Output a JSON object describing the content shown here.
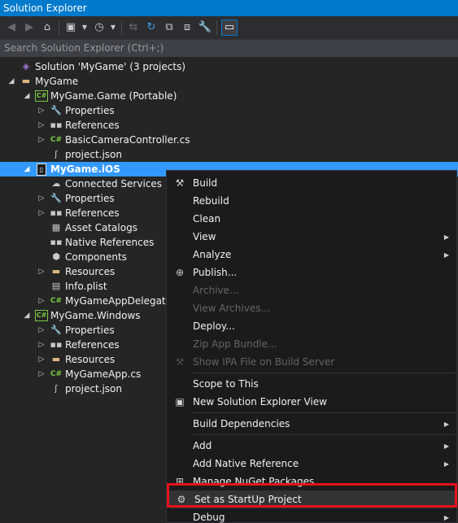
{
  "window": {
    "title": "Solution Explorer"
  },
  "toolbar": {
    "buttons": [
      {
        "icon": "back-icon",
        "glyph": "◀",
        "enabled": false
      },
      {
        "icon": "forward-icon",
        "glyph": "▶",
        "enabled": false
      },
      {
        "icon": "home-icon",
        "glyph": "⌂",
        "enabled": true
      },
      {
        "icon": "switch-views-icon",
        "glyph": "▣",
        "enabled": true
      },
      {
        "icon": "pending-changes-filter-icon",
        "glyph": "◷",
        "enabled": true
      },
      {
        "icon": "sync-with-active-document-icon",
        "glyph": "⇆",
        "enabled": false
      },
      {
        "icon": "refresh-icon",
        "glyph": "↻",
        "enabled": true
      },
      {
        "icon": "collapse-all-icon",
        "glyph": "⧉",
        "enabled": true
      },
      {
        "icon": "show-all-files-icon",
        "glyph": "⧈",
        "enabled": true
      },
      {
        "icon": "properties-icon",
        "glyph": "🔧",
        "enabled": true
      },
      {
        "icon": "preview-selected-items-icon",
        "glyph": "▭",
        "enabled": true
      }
    ]
  },
  "search": {
    "placeholder": "Search Solution Explorer (Ctrl+;)"
  },
  "tree": [
    {
      "label": "Solution 'MyGame' (3 projects)",
      "icon": "solution-icon",
      "glyph": "◈",
      "depth": 0,
      "expander": ""
    },
    {
      "label": "MyGame",
      "icon": "folder-icon",
      "glyph": "▬",
      "depth": 0,
      "expander": "◢"
    },
    {
      "label": "MyGame.Game (Portable)",
      "icon": "csharp-project-icon",
      "glyph": "C#",
      "depth": 1,
      "expander": "◢"
    },
    {
      "label": "Properties",
      "icon": "wrench-icon",
      "glyph": "🔧",
      "depth": 2,
      "expander": "▷"
    },
    {
      "label": "References",
      "icon": "references-icon",
      "glyph": "▪▪",
      "depth": 2,
      "expander": "▷"
    },
    {
      "label": "BasicCameraController.cs",
      "icon": "csharp-file-icon",
      "glyph": "C#",
      "depth": 2,
      "expander": "▷"
    },
    {
      "label": "project.json",
      "icon": "json-file-icon",
      "glyph": "ʃ",
      "depth": 2,
      "expander": ""
    },
    {
      "label": "MyGame.iOS",
      "icon": "ios-project-icon",
      "glyph": "▯",
      "depth": 1,
      "expander": "◢",
      "selected": true
    },
    {
      "label": "Connected Services",
      "icon": "connected-services-icon",
      "glyph": "☁",
      "depth": 2,
      "expander": ""
    },
    {
      "label": "Properties",
      "icon": "wrench-icon",
      "glyph": "🔧",
      "depth": 2,
      "expander": "▷"
    },
    {
      "label": "References",
      "icon": "references-icon",
      "glyph": "▪▪",
      "depth": 2,
      "expander": "▷"
    },
    {
      "label": "Asset Catalogs",
      "icon": "asset-catalogs-icon",
      "glyph": "▦",
      "depth": 2,
      "expander": ""
    },
    {
      "label": "Native References",
      "icon": "native-references-icon",
      "glyph": "▪▪",
      "depth": 2,
      "expander": ""
    },
    {
      "label": "Components",
      "icon": "components-icon",
      "glyph": "⬢",
      "depth": 2,
      "expander": ""
    },
    {
      "label": "Resources",
      "icon": "folder-icon",
      "glyph": "▬",
      "depth": 2,
      "expander": "▷"
    },
    {
      "label": "Info.plist",
      "icon": "plist-file-icon",
      "glyph": "▤",
      "depth": 2,
      "expander": ""
    },
    {
      "label": "MyGameAppDelegate",
      "icon": "csharp-file-icon",
      "glyph": "C#",
      "depth": 2,
      "expander": "▷"
    },
    {
      "label": "MyGame.Windows",
      "icon": "csharp-project-icon",
      "glyph": "C#",
      "depth": 1,
      "expander": "◢"
    },
    {
      "label": "Properties",
      "icon": "wrench-icon",
      "glyph": "🔧",
      "depth": 2,
      "expander": "▷"
    },
    {
      "label": "References",
      "icon": "references-icon",
      "glyph": "▪▪",
      "depth": 2,
      "expander": "▷"
    },
    {
      "label": "Resources",
      "icon": "folder-icon",
      "glyph": "▬",
      "depth": 2,
      "expander": "▷"
    },
    {
      "label": "MyGameApp.cs",
      "icon": "csharp-file-icon",
      "glyph": "C#",
      "depth": 2,
      "expander": "▷"
    },
    {
      "label": "project.json",
      "icon": "json-file-icon",
      "glyph": "ʃ",
      "depth": 2,
      "expander": ""
    }
  ],
  "context_menu": {
    "items": [
      {
        "label": "Build",
        "icon": "build-icon",
        "glyph": "⚒",
        "enabled": true,
        "submenu": false
      },
      {
        "label": "Rebuild",
        "enabled": true,
        "submenu": false
      },
      {
        "label": "Clean",
        "enabled": true,
        "submenu": false
      },
      {
        "label": "View",
        "enabled": true,
        "submenu": true
      },
      {
        "label": "Analyze",
        "enabled": true,
        "submenu": true
      },
      {
        "label": "Publish...",
        "icon": "globe-icon",
        "glyph": "⊕",
        "enabled": true,
        "submenu": false
      },
      {
        "label": "Archive...",
        "enabled": false,
        "submenu": false
      },
      {
        "label": "View Archives...",
        "enabled": false,
        "submenu": false
      },
      {
        "label": "Deploy...",
        "enabled": true,
        "submenu": false
      },
      {
        "label": "Zip App Bundle...",
        "enabled": false,
        "submenu": false
      },
      {
        "label": "Show IPA File on Build Server",
        "icon": "build-server-icon",
        "glyph": "⚒",
        "enabled": false,
        "submenu": false
      },
      {
        "separator": true
      },
      {
        "label": "Scope to This",
        "enabled": true,
        "submenu": false
      },
      {
        "label": "New Solution Explorer View",
        "icon": "new-view-icon",
        "glyph": "▣",
        "enabled": true,
        "submenu": false
      },
      {
        "separator": true
      },
      {
        "label": "Build Dependencies",
        "enabled": true,
        "submenu": true
      },
      {
        "separator": true
      },
      {
        "label": "Add",
        "enabled": true,
        "submenu": true
      },
      {
        "label": "Add Native Reference",
        "enabled": true,
        "submenu": true
      },
      {
        "label": "Manage NuGet Packages...",
        "icon": "nuget-icon",
        "glyph": "⊞",
        "enabled": true,
        "submenu": false
      },
      {
        "label": "Set as StartUp Project",
        "icon": "gear-icon",
        "glyph": "⚙",
        "enabled": true,
        "submenu": false,
        "hot": true
      },
      {
        "label": "Debug",
        "enabled": true,
        "submenu": true
      }
    ]
  },
  "colors": {
    "accent": "#007acc",
    "selection": "#3399ff",
    "highlight_box": "#e8111c",
    "csharp": "#7ac943",
    "folder": "#dcb67a"
  }
}
